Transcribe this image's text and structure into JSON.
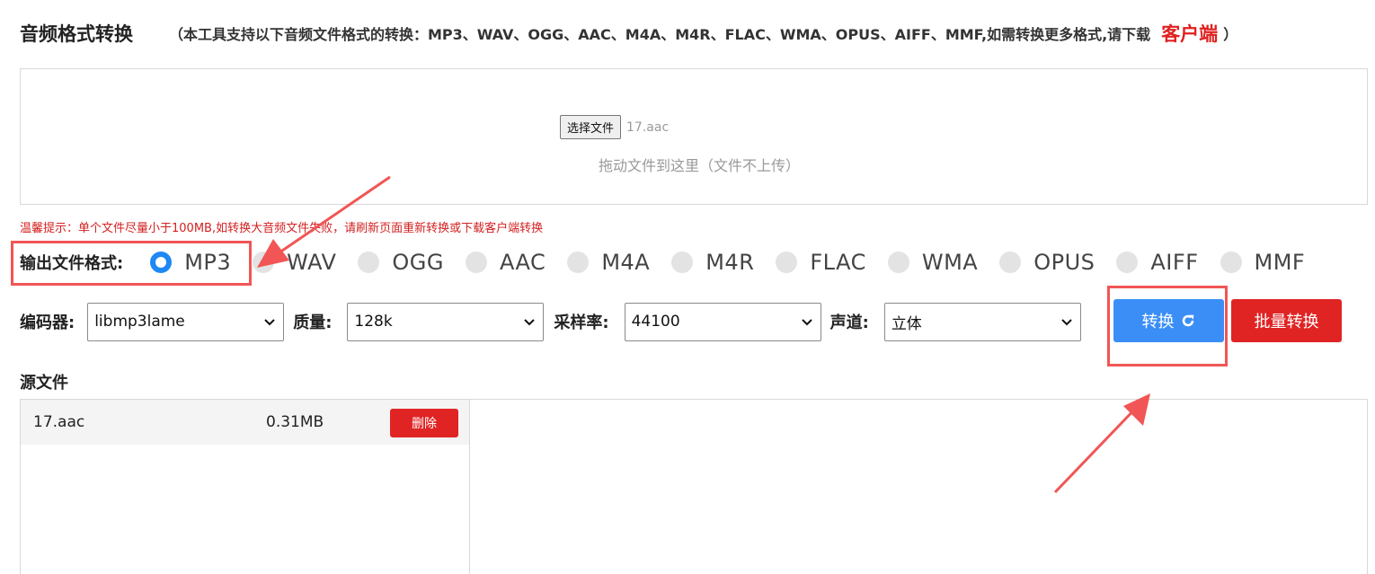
{
  "header": {
    "title": "音频格式转换",
    "note_open": "（本工具支持以下音频文件格式的转换：MP3、WAV、OGG、AAC、M4A、M4R、FLAC、WMA、OPUS、AIFF、MMF,如需转换更多格式,请下载",
    "client_link": "客户端",
    "note_close": "）"
  },
  "dropzone": {
    "choose_button": "选择文件",
    "chosen_file": "17.aac",
    "hint": "拖动文件到这里（文件不上传）"
  },
  "warning": "温馨提示：单个文件尽量小于100MB,如转换大音频文件失败，请刷新页面重新转换或下载客户端转换",
  "output_format": {
    "label": "输出文件格式:",
    "selected": "MP3",
    "options": [
      "MP3",
      "WAV",
      "OGG",
      "AAC",
      "M4A",
      "M4R",
      "FLAC",
      "WMA",
      "OPUS",
      "AIFF",
      "MMF"
    ]
  },
  "settings": {
    "encoder_label": "编码器:",
    "encoder_value": "libmp3lame",
    "quality_label": "质量:",
    "quality_value": "128k",
    "samplerate_label": "采样率:",
    "samplerate_value": "44100",
    "channel_label": "声道:",
    "channel_value": "立体"
  },
  "actions": {
    "convert_label": "转换",
    "batch_label": "批量转换"
  },
  "source": {
    "title": "源文件",
    "files": [
      {
        "name": "17.aac",
        "size": "0.31MB",
        "delete_label": "删除"
      }
    ]
  },
  "colors": {
    "accent_blue": "#3a8ef6",
    "danger_red": "#e02424",
    "annotation_red": "#f25555"
  }
}
